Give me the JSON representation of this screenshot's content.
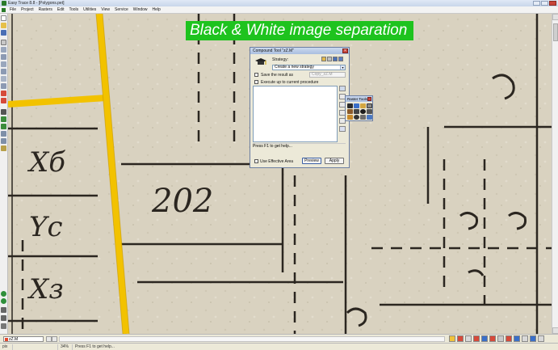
{
  "app": {
    "title": "Easy Trace 8.8 - [Polygons.pet]"
  },
  "menu": {
    "items": [
      "File",
      "Project",
      "Rasters",
      "Edit",
      "Tools",
      "Utilities",
      "View",
      "Service",
      "Window",
      "Help"
    ]
  },
  "banner": {
    "text": "Black & White image separation"
  },
  "map_labels": [
    "Xб",
    "Yс",
    "Xз",
    "202"
  ],
  "dialog": {
    "title": "Compound Tool \"zZ.M\"",
    "strategy_label": "Strategy:",
    "strategy_value": "Create a new strategy",
    "save_result_label": "Save the result as",
    "save_result_value": "Copy_zZ.M",
    "execute_label": "Execute up to current procedure",
    "status_text": "Press F1 to get help...",
    "use_effective_area_label": "Use Effective Area",
    "preview_label": "Preview",
    "apply_label": "Apply"
  },
  "raster_tools": {
    "title": "Raster Tools"
  },
  "tabbar": {
    "layer_name": "zZ.M"
  },
  "statusbar": {
    "cells": [
      "pix",
      "",
      "34%",
      "Press F1 to get help..."
    ]
  },
  "colors": {
    "banner_bg": "#1ec31e",
    "road_yellow": "#f2c200",
    "paper": "#d9d2c0",
    "ink": "#2b2620"
  }
}
